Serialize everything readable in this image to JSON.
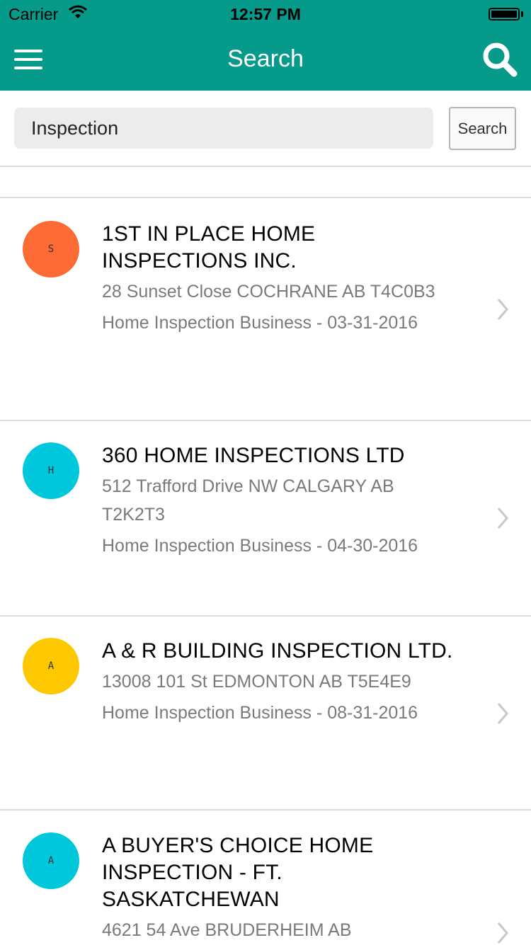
{
  "status_bar": {
    "carrier": "Carrier",
    "time": "12:57 PM"
  },
  "nav": {
    "title": "Search",
    "menu_icon": "hamburger-menu-icon",
    "search_icon": "search-icon"
  },
  "search": {
    "query": "Inspection",
    "button_label": "Search"
  },
  "colors": {
    "brand": "#059a8a"
  },
  "results": [
    {
      "initial": "S",
      "avatar_color": "#fd6a35",
      "name": "1ST IN PLACE HOME INSPECTIONS INC.",
      "address": "28 Sunset Close COCHRANE AB T4C0B3",
      "type": "Home Inspection Business - 03-31-2016"
    },
    {
      "initial": "H",
      "avatar_color": "#00c8dc",
      "name": "360 HOME INSPECTIONS LTD",
      "address": "512 Trafford Drive NW CALGARY AB T2K2T3",
      "type": "Home Inspection Business - 04-30-2016"
    },
    {
      "initial": "A",
      "avatar_color": "#fec800",
      "name": "A & R BUILDING INSPECTION LTD.",
      "address": "13008 101 St EDMONTON AB T5E4E9",
      "type": "Home Inspection Business - 08-31-2016"
    },
    {
      "initial": "A",
      "avatar_color": "#00c8dc",
      "name": "A BUYER'S CHOICE HOME INSPECTION - FT. SASKATCHEWAN",
      "address": "4621 54 Ave BRUDERHEIM AB",
      "type": ""
    }
  ]
}
